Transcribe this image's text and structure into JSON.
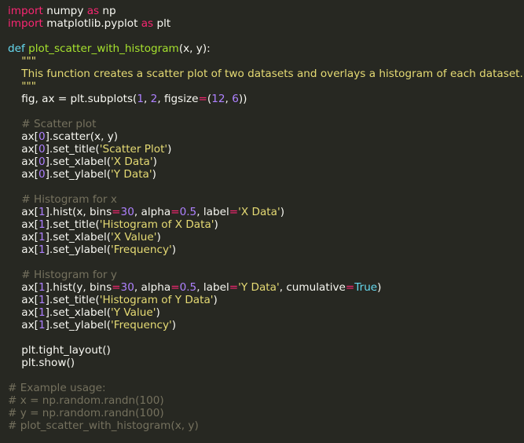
{
  "colors": {
    "background": "#272822",
    "plain": "#f8f8f2",
    "keyword": "#f92672",
    "function": "#a6e22e",
    "string": "#e6db74",
    "comment": "#75715e",
    "number": "#ae81ff",
    "builtin": "#66d9ef"
  },
  "code": {
    "lines": [
      [
        [
          "kw",
          "import"
        ],
        [
          "pl",
          " numpy "
        ],
        [
          "kw",
          "as"
        ],
        [
          "pl",
          " np"
        ]
      ],
      [
        [
          "kw",
          "import"
        ],
        [
          "pl",
          " matplotlib.pyplot "
        ],
        [
          "kw",
          "as"
        ],
        [
          "pl",
          " plt"
        ]
      ],
      [],
      [
        [
          "bi",
          "def"
        ],
        [
          "pl",
          " "
        ],
        [
          "fn",
          "plot_scatter_with_histogram"
        ],
        [
          "pl",
          "(x, y):"
        ]
      ],
      [
        [
          "st",
          "    \"\"\""
        ]
      ],
      [
        [
          "st",
          "    This function creates a scatter plot of two datasets and overlays a histogram of each dataset."
        ]
      ],
      [
        [
          "st",
          "    \"\"\""
        ]
      ],
      [
        [
          "pl",
          "    fig, ax = plt.subplots("
        ],
        [
          "nm",
          "1"
        ],
        [
          "pl",
          ", "
        ],
        [
          "nm",
          "2"
        ],
        [
          "pl",
          ", figsize"
        ],
        [
          "op",
          "="
        ],
        [
          "pl",
          "("
        ],
        [
          "nm",
          "12"
        ],
        [
          "pl",
          ", "
        ],
        [
          "nm",
          "6"
        ],
        [
          "pl",
          "))"
        ]
      ],
      [],
      [
        [
          "cm",
          "    # Scatter plot"
        ]
      ],
      [
        [
          "pl",
          "    ax["
        ],
        [
          "nm",
          "0"
        ],
        [
          "pl",
          "].scatter(x, y)"
        ]
      ],
      [
        [
          "pl",
          "    ax["
        ],
        [
          "nm",
          "0"
        ],
        [
          "pl",
          "].set_title("
        ],
        [
          "st",
          "'Scatter Plot'"
        ],
        [
          "pl",
          ")"
        ]
      ],
      [
        [
          "pl",
          "    ax["
        ],
        [
          "nm",
          "0"
        ],
        [
          "pl",
          "].set_xlabel("
        ],
        [
          "st",
          "'X Data'"
        ],
        [
          "pl",
          ")"
        ]
      ],
      [
        [
          "pl",
          "    ax["
        ],
        [
          "nm",
          "0"
        ],
        [
          "pl",
          "].set_ylabel("
        ],
        [
          "st",
          "'Y Data'"
        ],
        [
          "pl",
          ")"
        ]
      ],
      [],
      [
        [
          "cm",
          "    # Histogram for x"
        ]
      ],
      [
        [
          "pl",
          "    ax["
        ],
        [
          "nm",
          "1"
        ],
        [
          "pl",
          "].hist(x, bins"
        ],
        [
          "op",
          "="
        ],
        [
          "nm",
          "30"
        ],
        [
          "pl",
          ", alpha"
        ],
        [
          "op",
          "="
        ],
        [
          "nm",
          "0.5"
        ],
        [
          "pl",
          ", label"
        ],
        [
          "op",
          "="
        ],
        [
          "st",
          "'X Data'"
        ],
        [
          "pl",
          ")"
        ]
      ],
      [
        [
          "pl",
          "    ax["
        ],
        [
          "nm",
          "1"
        ],
        [
          "pl",
          "].set_title("
        ],
        [
          "st",
          "'Histogram of X Data'"
        ],
        [
          "pl",
          ")"
        ]
      ],
      [
        [
          "pl",
          "    ax["
        ],
        [
          "nm",
          "1"
        ],
        [
          "pl",
          "].set_xlabel("
        ],
        [
          "st",
          "'X Value'"
        ],
        [
          "pl",
          ")"
        ]
      ],
      [
        [
          "pl",
          "    ax["
        ],
        [
          "nm",
          "1"
        ],
        [
          "pl",
          "].set_ylabel("
        ],
        [
          "st",
          "'Frequency'"
        ],
        [
          "pl",
          ")"
        ]
      ],
      [],
      [
        [
          "cm",
          "    # Histogram for y"
        ]
      ],
      [
        [
          "pl",
          "    ax["
        ],
        [
          "nm",
          "1"
        ],
        [
          "pl",
          "].hist(y, bins"
        ],
        [
          "op",
          "="
        ],
        [
          "nm",
          "30"
        ],
        [
          "pl",
          ", alpha"
        ],
        [
          "op",
          "="
        ],
        [
          "nm",
          "0.5"
        ],
        [
          "pl",
          ", label"
        ],
        [
          "op",
          "="
        ],
        [
          "st",
          "'Y Data'"
        ],
        [
          "pl",
          ", cumulative"
        ],
        [
          "op",
          "="
        ],
        [
          "bi",
          "True"
        ],
        [
          "pl",
          ")"
        ]
      ],
      [
        [
          "pl",
          "    ax["
        ],
        [
          "nm",
          "1"
        ],
        [
          "pl",
          "].set_title("
        ],
        [
          "st",
          "'Histogram of Y Data'"
        ],
        [
          "pl",
          ")"
        ]
      ],
      [
        [
          "pl",
          "    ax["
        ],
        [
          "nm",
          "1"
        ],
        [
          "pl",
          "].set_xlabel("
        ],
        [
          "st",
          "'Y Value'"
        ],
        [
          "pl",
          ")"
        ]
      ],
      [
        [
          "pl",
          "    ax["
        ],
        [
          "nm",
          "1"
        ],
        [
          "pl",
          "].set_ylabel("
        ],
        [
          "st",
          "'Frequency'"
        ],
        [
          "pl",
          ")"
        ]
      ],
      [],
      [
        [
          "pl",
          "    plt.tight_layout()"
        ]
      ],
      [
        [
          "pl",
          "    plt.show()"
        ]
      ],
      [],
      [
        [
          "cm",
          "# Example usage:"
        ]
      ],
      [
        [
          "cm",
          "# x = np.random.randn(100)"
        ]
      ],
      [
        [
          "cm",
          "# y = np.random.randn(100)"
        ]
      ],
      [
        [
          "cm",
          "# plot_scatter_with_histogram(x, y)"
        ]
      ]
    ]
  }
}
